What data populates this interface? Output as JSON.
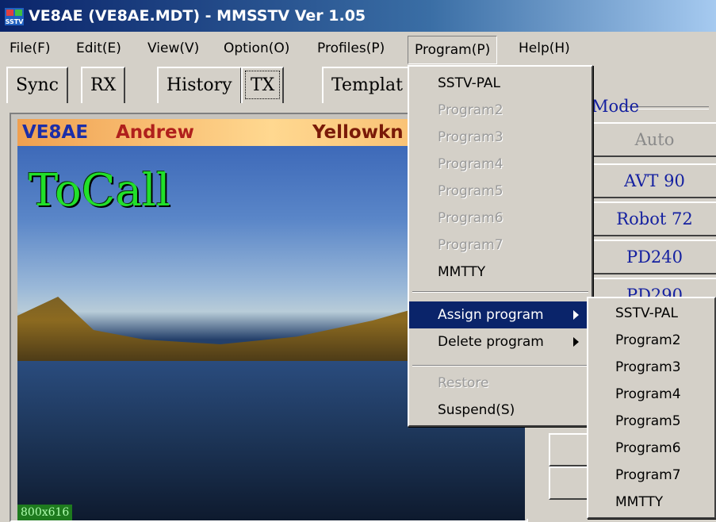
{
  "title": "VE8AE (VE8AE.MDT) - MMSSTV Ver 1.05",
  "app_icon_text": "SSTV",
  "menubar": [
    {
      "id": "file",
      "label": "File(F)"
    },
    {
      "id": "edit",
      "label": "Edit(E)"
    },
    {
      "id": "view",
      "label": "View(V)"
    },
    {
      "id": "option",
      "label": "Option(O)"
    },
    {
      "id": "profiles",
      "label": "Profiles(P)"
    },
    {
      "id": "program",
      "label": "Program(P)",
      "open": true
    },
    {
      "id": "help",
      "label": "Help(H)"
    }
  ],
  "tabs": [
    {
      "label": "Sync"
    },
    {
      "label": "RX"
    },
    {
      "label": "History"
    },
    {
      "label": "TX",
      "active": true
    },
    {
      "label": "Templat"
    }
  ],
  "image": {
    "callsign": "VE8AE",
    "name": "Andrew",
    "location": "Yellowkn",
    "tocall": "ToCall",
    "size": "800x616"
  },
  "mode": {
    "label": "Mode",
    "buttons": [
      {
        "label": "Auto",
        "disabled": true
      },
      {
        "label": "AVT 90"
      },
      {
        "label": "Robot 72"
      },
      {
        "label": "PD240"
      },
      {
        "label": "PD290"
      }
    ]
  },
  "program_menu": {
    "items": [
      {
        "label": "SSTV-PAL",
        "disabled": false
      },
      {
        "label": "Program2",
        "disabled": true
      },
      {
        "label": "Program3",
        "disabled": true
      },
      {
        "label": "Program4",
        "disabled": true
      },
      {
        "label": "Program5",
        "disabled": true
      },
      {
        "label": "Program6",
        "disabled": true
      },
      {
        "label": "Program7",
        "disabled": true
      },
      {
        "label": "MMTTY",
        "disabled": false
      }
    ],
    "assign": "Assign program",
    "delete": "Delete program",
    "restore": "Restore",
    "suspend": "Suspend(S)"
  },
  "assign_submenu": [
    "SSTV-PAL",
    "Program2",
    "Program3",
    "Program4",
    "Program5",
    "Program6",
    "Program7",
    "MMTTY"
  ],
  "colors": {
    "highlight": "#0a246a",
    "mode_text": "#1420a0",
    "tocall": "#21e02a"
  }
}
